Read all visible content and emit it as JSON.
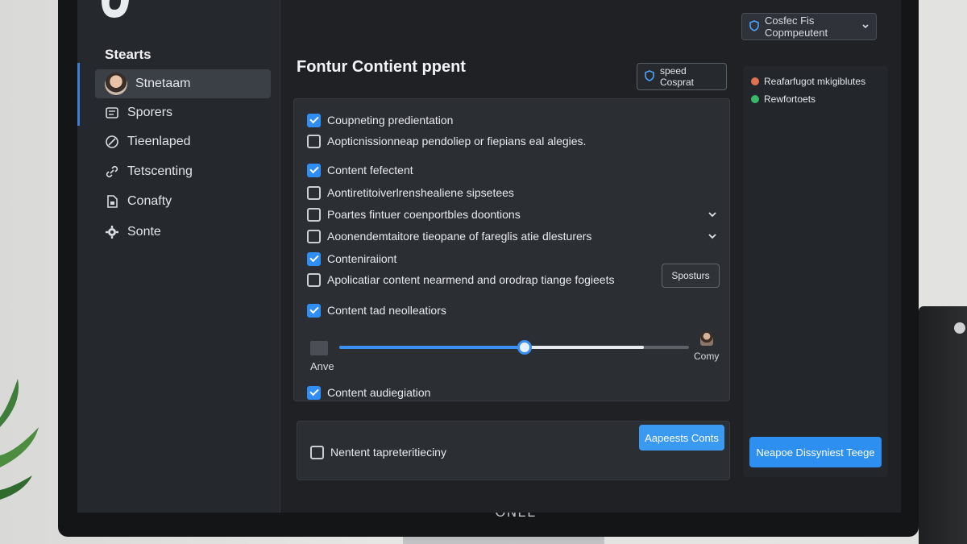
{
  "sidebar": {
    "heading": "Stearts",
    "items": [
      {
        "label": "Stnetaam",
        "icon": "avatar-icon",
        "active": true
      },
      {
        "label": "Sporers",
        "icon": "document-icon"
      },
      {
        "label": "Tieenlaped",
        "icon": "tag-icon"
      },
      {
        "label": "Tetscenting",
        "icon": "link-icon"
      },
      {
        "label": "Conafty",
        "icon": "file-icon"
      },
      {
        "label": "Sonte",
        "icon": "gear-icon"
      }
    ]
  },
  "topbar": {
    "dropdown_label": "Cosfec Fis  Copmpeutent"
  },
  "main": {
    "title": "Fontur Contient ppent",
    "header_button": "speed Cosprat",
    "options": [
      {
        "label": "Coupneting predientation",
        "checked": true
      },
      {
        "label": "Aopticnissionneap pendoliep or fiepians eal alegies.",
        "checked": false
      },
      {
        "label": "Content fefectent",
        "checked": true
      },
      {
        "label": "Aontiretitoiverlrenshealiene sipsetees",
        "checked": false
      },
      {
        "label": "Poartes fintuer coenportbles doontions",
        "checked": false
      },
      {
        "label": "Aoonendemtaitore tieopane of fareglis atie dlesturers",
        "checked": false
      },
      {
        "label": "Conteniraiiont",
        "checked": true
      },
      {
        "label": "Apolicatiar content nearmend and orodrap tiange fogieets",
        "checked": false
      },
      {
        "label": "Content tad neolleatiors",
        "checked": true
      },
      {
        "label": "Content audiegiation",
        "checked": true
      }
    ],
    "inline_button": "Sposturs",
    "slider": {
      "min_label": "Anve",
      "max_label": "Comy",
      "value_fraction": 0.53,
      "light_fraction": 0.87
    },
    "footer": {
      "option": {
        "label": "Nentent tapreteritieciny",
        "checked": false
      },
      "primary_button": "Aapeests Conts"
    }
  },
  "right_panel": {
    "items": [
      {
        "label": "Reafarfugot mkigiblutes",
        "color": "#e0704f"
      },
      {
        "label": "Rewfortoets",
        "color": "#39b86a"
      }
    ],
    "button": "Neapoe Dissyniest Teege"
  },
  "monitor": {
    "brand": "ONEE"
  },
  "colors": {
    "accent": "#2f8ef5",
    "panel": "#2b2e33",
    "sidebar": "#25282c"
  }
}
